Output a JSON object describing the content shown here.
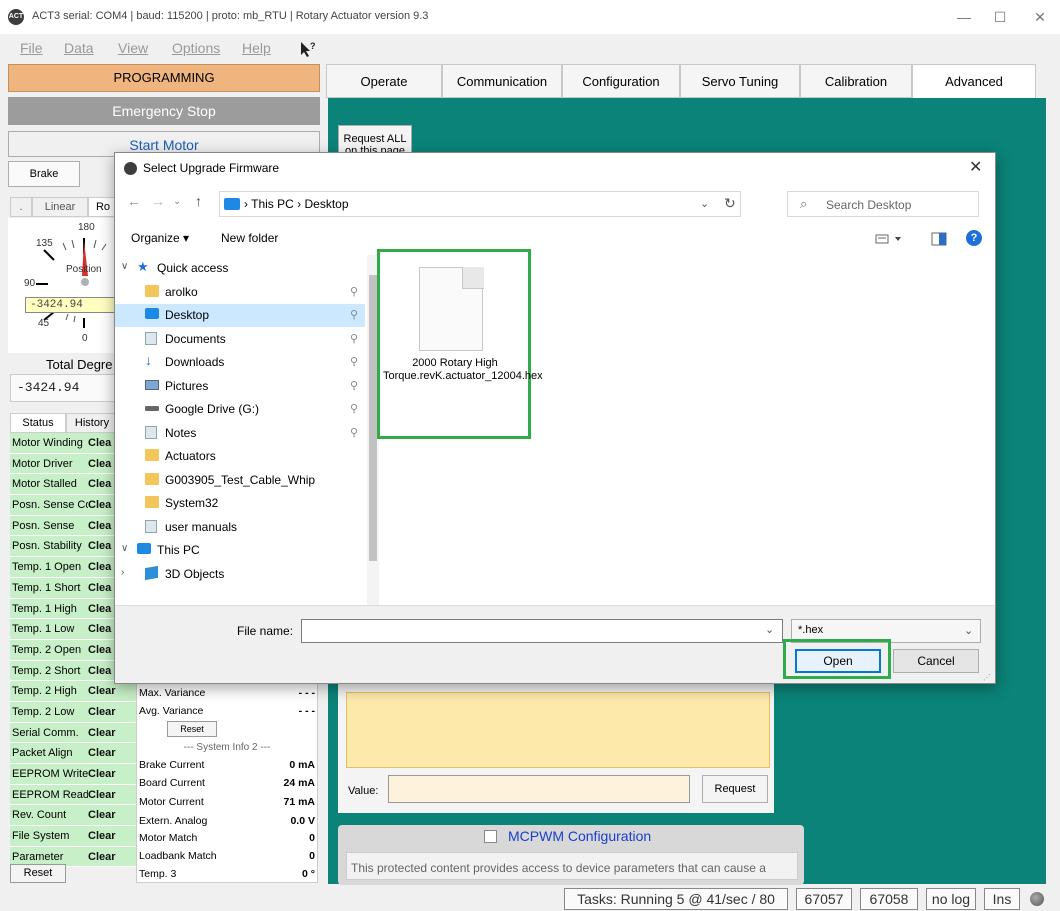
{
  "app": {
    "title": "ACT3  serial: COM4 | baud: 115200 | proto: mb_RTU | Rotary Actuator version 9.3",
    "icon_text": "ACT",
    "window_controls": {
      "minimize": "—",
      "maximize": "☐",
      "close": "✕"
    }
  },
  "menu": [
    "File",
    "Data",
    "View",
    "Options",
    "Help"
  ],
  "left": {
    "programming": "PROGRAMMING",
    "emergency_stop": "Emergency Stop",
    "start_motor": "Start Motor",
    "brake": "Brake",
    "gauge_tabs": [
      ".",
      "Linear",
      "Ro"
    ],
    "gauge_labels": {
      "top": "180",
      "upper_left": "135",
      "left": "90",
      "lower_left": "45",
      "bottom": "0",
      "center": "Position"
    },
    "position_readout": "-3424.94",
    "total_degrees_label": "Total Degre",
    "total_degrees_value": "-3424.94",
    "status_tabs": [
      "Status",
      "History"
    ],
    "status_rows": [
      {
        "name": "Motor Winding",
        "value": "Clea"
      },
      {
        "name": "Motor Driver",
        "value": "Clea"
      },
      {
        "name": "Motor Stalled",
        "value": "Clea"
      },
      {
        "name": "Posn. Sense Co",
        "value": "Clea"
      },
      {
        "name": "Posn. Sense",
        "value": "Clea"
      },
      {
        "name": "Posn. Stability",
        "value": "Clea"
      },
      {
        "name": "Temp. 1 Open",
        "value": "Clea"
      },
      {
        "name": "Temp. 1 Short",
        "value": "Clea"
      },
      {
        "name": "Temp. 1 High",
        "value": "Clea"
      },
      {
        "name": "Temp. 1 Low",
        "value": "Clea"
      },
      {
        "name": "Temp. 2 Open",
        "value": "Clea"
      },
      {
        "name": "Temp. 2 Short",
        "value": "Clea"
      },
      {
        "name": "Temp. 2 High",
        "value": "Clear"
      },
      {
        "name": "Temp. 2 Low",
        "value": "Clear"
      },
      {
        "name": "Serial Comm.",
        "value": "Clear"
      },
      {
        "name": "Packet Align",
        "value": "Clear"
      },
      {
        "name": "EEPROM Write",
        "value": "Clear"
      },
      {
        "name": "EEPROM Read",
        "value": "Clear"
      },
      {
        "name": "Rev. Count",
        "value": "Clear"
      },
      {
        "name": "File System",
        "value": "Clear"
      },
      {
        "name": "Parameter",
        "value": "Clear"
      }
    ],
    "status_reset": "Reset",
    "sysinfo": {
      "max_variance_label": "Max. Variance",
      "max_variance": "- - -",
      "avg_variance_label": "Avg. Variance",
      "avg_variance": "- - -",
      "reset": "Reset",
      "header2": "--- System Info 2 ---",
      "brake_current_label": "Brake Current",
      "brake_current": "0 mA",
      "board_current_label": "Board Current",
      "board_current": "24 mA",
      "motor_current_label": "Motor Current",
      "motor_current": "71 mA",
      "extern_analog_label": "Extern. Analog",
      "extern_analog": "0.0 V",
      "motor_match_label": "Motor Match",
      "motor_match": "0",
      "loadbank_match_label": "Loadbank Match",
      "loadbank_match": "0",
      "temp3_label": "Temp. 3",
      "temp3": "0 °"
    }
  },
  "tabs": [
    "Operate",
    "Communication",
    "Configuration",
    "Servo Tuning",
    "Calibration",
    "Advanced"
  ],
  "active_tab": "Advanced",
  "advanced": {
    "request_all": "Request ALL on this page",
    "value_label": "Value:",
    "request": "Request",
    "mcpwm_title": "MCPWM Configuration",
    "mcpwm_text": "This protected content provides access to device parameters that can cause a"
  },
  "statusbar": {
    "tasks": "Tasks: Running 5 @ 41/sec / 80",
    "n1": "67057",
    "n2": "67058",
    "log": "no log",
    "ins": "Ins"
  },
  "dialog": {
    "title": "Select Upgrade Firmware",
    "path": [
      "This PC",
      "Desktop"
    ],
    "search_placeholder": "Search Desktop",
    "organize": "Organize ▾",
    "new_folder": "New folder",
    "nav": [
      {
        "label": "Quick access",
        "kind": "star",
        "indent": 1,
        "expander": "v"
      },
      {
        "label": "arolko",
        "kind": "folder",
        "indent": 2,
        "pin": true
      },
      {
        "label": "Desktop",
        "kind": "blue",
        "indent": 2,
        "pin": true,
        "selected": true
      },
      {
        "label": "Documents",
        "kind": "docs",
        "indent": 2,
        "pin": true
      },
      {
        "label": "Downloads",
        "kind": "down",
        "indent": 2,
        "pin": true
      },
      {
        "label": "Pictures",
        "kind": "pics",
        "indent": 2,
        "pin": true
      },
      {
        "label": "Google Drive (G:)",
        "kind": "drive",
        "indent": 2,
        "pin": true
      },
      {
        "label": "Notes",
        "kind": "docs",
        "indent": 2,
        "pin": true
      },
      {
        "label": "Actuators",
        "kind": "folder",
        "indent": 2
      },
      {
        "label": "G003905_Test_Cable_Whip",
        "kind": "folder",
        "indent": 2
      },
      {
        "label": "System32",
        "kind": "folder",
        "indent": 2
      },
      {
        "label": "user manuals",
        "kind": "docs",
        "indent": 2
      },
      {
        "label": "This PC",
        "kind": "blue",
        "indent": 1,
        "expander": "v"
      },
      {
        "label": "3D Objects",
        "kind": "obj3d",
        "indent": 2,
        "expander": ">"
      }
    ],
    "file": "2000 Rotary High Torque.revK.actuator_12004.hex",
    "file_name_label": "File name:",
    "file_name_value": "",
    "file_type": "*.hex",
    "open": "Open",
    "cancel": "Cancel"
  },
  "colors": {
    "teal": "#0b8378",
    "highlight": "#2eab4a",
    "status_green": "#c8f0c8",
    "programming": "#f0b57e"
  }
}
